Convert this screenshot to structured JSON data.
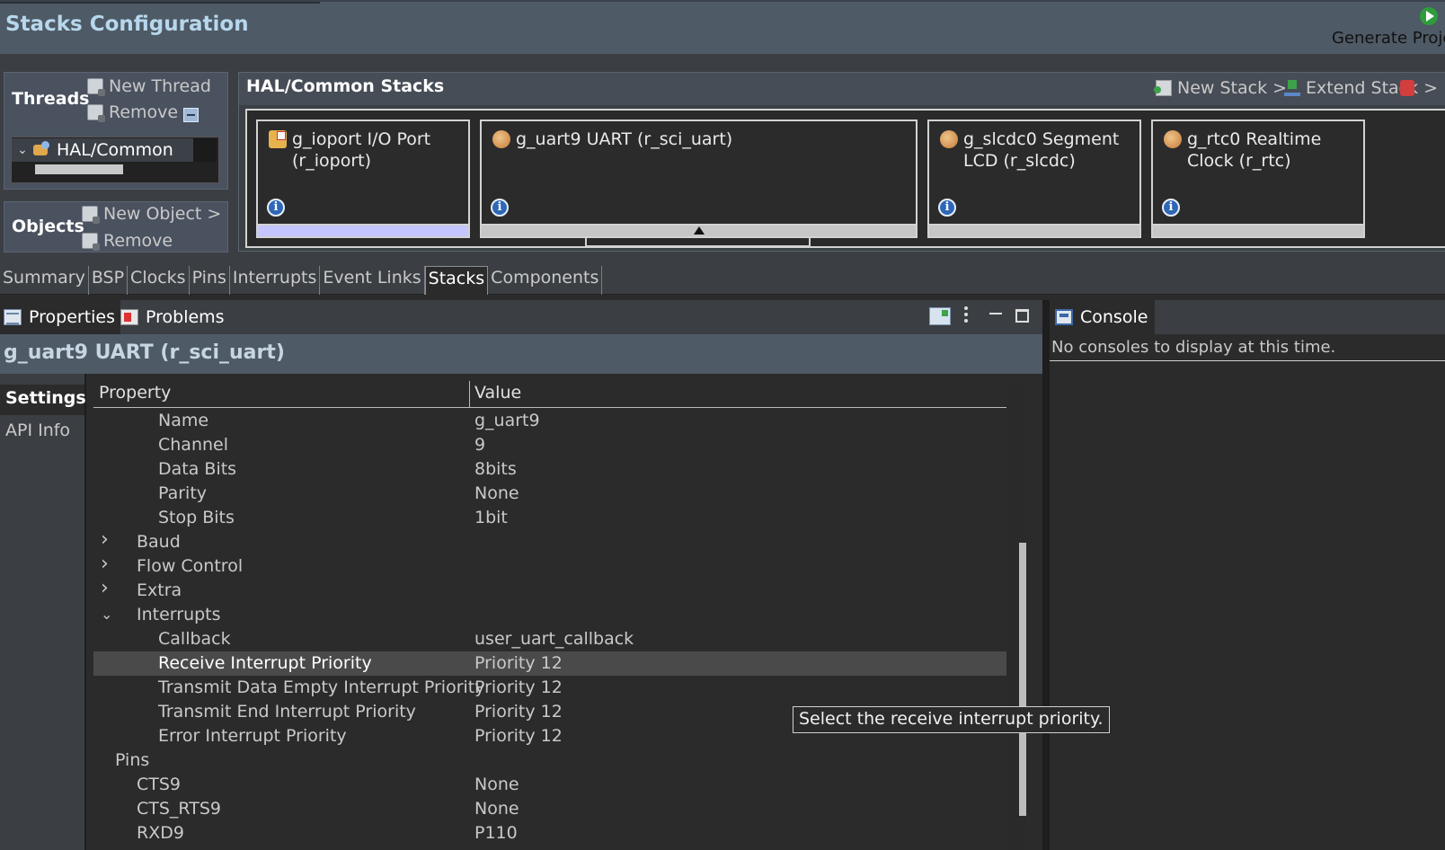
{
  "header": {
    "title": "Stacks Configuration",
    "generate_label": "Generate Proje"
  },
  "threads": {
    "title": "Threads",
    "new_thread": "New Thread",
    "remove": "Remove",
    "tree_item": "HAL/Common"
  },
  "objects": {
    "title": "Objects",
    "new_object": "New Object >",
    "remove": "Remove"
  },
  "stacks": {
    "title": "HAL/Common Stacks",
    "new_stack": "New Stack >",
    "extend_stack": "Extend Stack >",
    "cards": [
      {
        "title": "g_ioport I/O Port (r_ioport)",
        "selected": true
      },
      {
        "title": "g_uart9 UART (r_sci_uart)",
        "selected": false
      },
      {
        "title": "g_slcdc0 Segment LCD (r_slcdc)",
        "selected": false
      },
      {
        "title": "g_rtc0 Realtime Clock (r_rtc)",
        "selected": false
      }
    ]
  },
  "editor_tabs": [
    "Summary",
    "BSP",
    "Clocks",
    "Pins",
    "Interrupts",
    "Event Links",
    "Stacks",
    "Components"
  ],
  "active_editor_tab": "Stacks",
  "properties_view": {
    "tabs": [
      "Properties",
      "Problems"
    ],
    "component_title": "g_uart9 UART (r_sci_uart)",
    "sidebar": [
      "Settings",
      "API Info"
    ],
    "columns": [
      "Property",
      "Value"
    ],
    "rows": [
      {
        "prop": "Name",
        "value": "g_uart9",
        "level": 3,
        "chevron": ""
      },
      {
        "prop": "Channel",
        "value": "9",
        "level": 3,
        "chevron": ""
      },
      {
        "prop": "Data Bits",
        "value": "8bits",
        "level": 3,
        "chevron": ""
      },
      {
        "prop": "Parity",
        "value": "None",
        "level": 3,
        "chevron": ""
      },
      {
        "prop": "Stop Bits",
        "value": "1bit",
        "level": 3,
        "chevron": ""
      },
      {
        "prop": "Baud",
        "value": "",
        "level": 2,
        "chevron": "collapsed"
      },
      {
        "prop": "Flow Control",
        "value": "",
        "level": 2,
        "chevron": "collapsed"
      },
      {
        "prop": "Extra",
        "value": "",
        "level": 2,
        "chevron": "collapsed"
      },
      {
        "prop": "Interrupts",
        "value": "",
        "level": 2,
        "chevron": "expanded"
      },
      {
        "prop": "Callback",
        "value": "user_uart_callback",
        "level": 3,
        "chevron": ""
      },
      {
        "prop": "Receive Interrupt Priority",
        "value": "Priority 12",
        "level": 3,
        "chevron": "",
        "selected": true
      },
      {
        "prop": "Transmit Data Empty Interrupt Priority",
        "value": "Priority 12",
        "level": 3,
        "chevron": ""
      },
      {
        "prop": "Transmit End Interrupt Priority",
        "value": "Priority 12",
        "level": 3,
        "chevron": ""
      },
      {
        "prop": "Error Interrupt Priority",
        "value": "Priority 12",
        "level": 3,
        "chevron": ""
      },
      {
        "prop": "Pins",
        "value": "",
        "level": 1,
        "chevron": "expanded"
      },
      {
        "prop": "CTS9",
        "value": "None",
        "level": 2,
        "chevron": ""
      },
      {
        "prop": "CTS_RTS9",
        "value": "None",
        "level": 2,
        "chevron": ""
      },
      {
        "prop": "RXD9",
        "value": "P110",
        "level": 2,
        "chevron": ""
      }
    ]
  },
  "console": {
    "tab": "Console",
    "message": "No consoles to display at this time."
  },
  "tooltip": "Select the receive interrupt priority."
}
